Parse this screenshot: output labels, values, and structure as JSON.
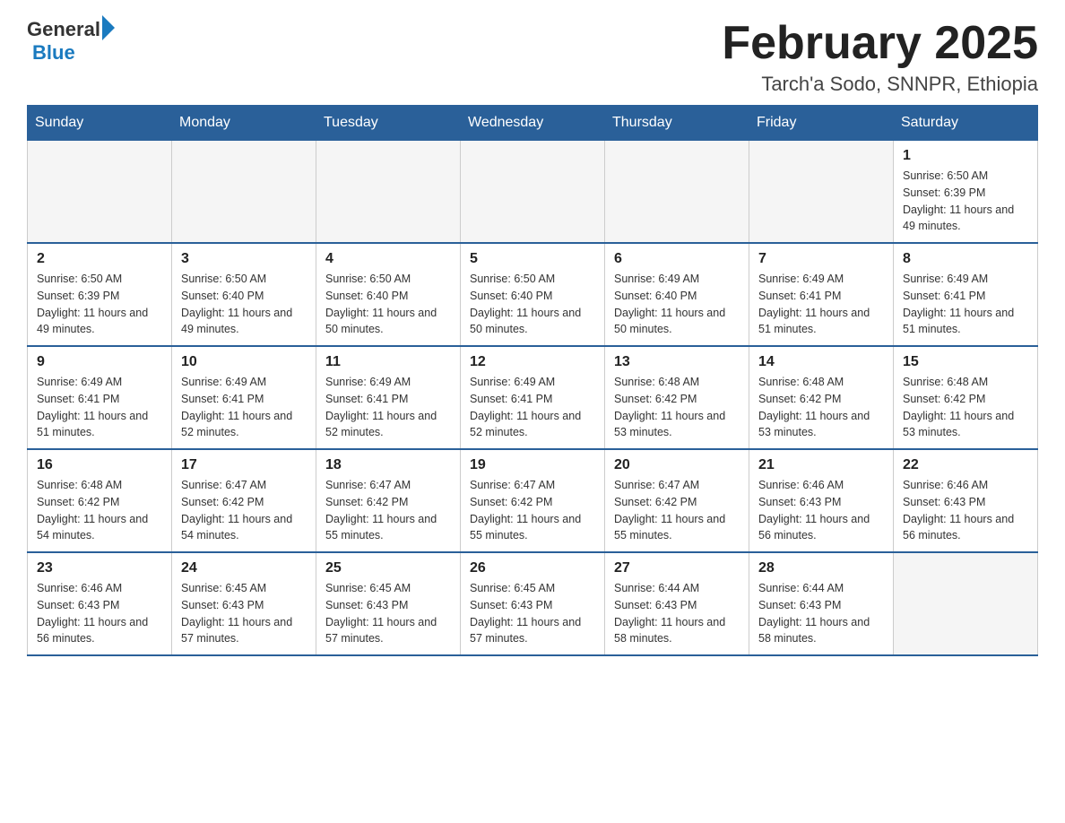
{
  "header": {
    "title": "February 2025",
    "subtitle": "Tarch'a Sodo, SNNPR, Ethiopia",
    "logo_general": "General",
    "logo_blue": "Blue"
  },
  "days_of_week": [
    "Sunday",
    "Monday",
    "Tuesday",
    "Wednesday",
    "Thursday",
    "Friday",
    "Saturday"
  ],
  "weeks": [
    {
      "days": [
        {
          "number": "",
          "info": ""
        },
        {
          "number": "",
          "info": ""
        },
        {
          "number": "",
          "info": ""
        },
        {
          "number": "",
          "info": ""
        },
        {
          "number": "",
          "info": ""
        },
        {
          "number": "",
          "info": ""
        },
        {
          "number": "1",
          "info": "Sunrise: 6:50 AM\nSunset: 6:39 PM\nDaylight: 11 hours and 49 minutes."
        }
      ]
    },
    {
      "days": [
        {
          "number": "2",
          "info": "Sunrise: 6:50 AM\nSunset: 6:39 PM\nDaylight: 11 hours and 49 minutes."
        },
        {
          "number": "3",
          "info": "Sunrise: 6:50 AM\nSunset: 6:40 PM\nDaylight: 11 hours and 49 minutes."
        },
        {
          "number": "4",
          "info": "Sunrise: 6:50 AM\nSunset: 6:40 PM\nDaylight: 11 hours and 50 minutes."
        },
        {
          "number": "5",
          "info": "Sunrise: 6:50 AM\nSunset: 6:40 PM\nDaylight: 11 hours and 50 minutes."
        },
        {
          "number": "6",
          "info": "Sunrise: 6:49 AM\nSunset: 6:40 PM\nDaylight: 11 hours and 50 minutes."
        },
        {
          "number": "7",
          "info": "Sunrise: 6:49 AM\nSunset: 6:41 PM\nDaylight: 11 hours and 51 minutes."
        },
        {
          "number": "8",
          "info": "Sunrise: 6:49 AM\nSunset: 6:41 PM\nDaylight: 11 hours and 51 minutes."
        }
      ]
    },
    {
      "days": [
        {
          "number": "9",
          "info": "Sunrise: 6:49 AM\nSunset: 6:41 PM\nDaylight: 11 hours and 51 minutes."
        },
        {
          "number": "10",
          "info": "Sunrise: 6:49 AM\nSunset: 6:41 PM\nDaylight: 11 hours and 52 minutes."
        },
        {
          "number": "11",
          "info": "Sunrise: 6:49 AM\nSunset: 6:41 PM\nDaylight: 11 hours and 52 minutes."
        },
        {
          "number": "12",
          "info": "Sunrise: 6:49 AM\nSunset: 6:41 PM\nDaylight: 11 hours and 52 minutes."
        },
        {
          "number": "13",
          "info": "Sunrise: 6:48 AM\nSunset: 6:42 PM\nDaylight: 11 hours and 53 minutes."
        },
        {
          "number": "14",
          "info": "Sunrise: 6:48 AM\nSunset: 6:42 PM\nDaylight: 11 hours and 53 minutes."
        },
        {
          "number": "15",
          "info": "Sunrise: 6:48 AM\nSunset: 6:42 PM\nDaylight: 11 hours and 53 minutes."
        }
      ]
    },
    {
      "days": [
        {
          "number": "16",
          "info": "Sunrise: 6:48 AM\nSunset: 6:42 PM\nDaylight: 11 hours and 54 minutes."
        },
        {
          "number": "17",
          "info": "Sunrise: 6:47 AM\nSunset: 6:42 PM\nDaylight: 11 hours and 54 minutes."
        },
        {
          "number": "18",
          "info": "Sunrise: 6:47 AM\nSunset: 6:42 PM\nDaylight: 11 hours and 55 minutes."
        },
        {
          "number": "19",
          "info": "Sunrise: 6:47 AM\nSunset: 6:42 PM\nDaylight: 11 hours and 55 minutes."
        },
        {
          "number": "20",
          "info": "Sunrise: 6:47 AM\nSunset: 6:42 PM\nDaylight: 11 hours and 55 minutes."
        },
        {
          "number": "21",
          "info": "Sunrise: 6:46 AM\nSunset: 6:43 PM\nDaylight: 11 hours and 56 minutes."
        },
        {
          "number": "22",
          "info": "Sunrise: 6:46 AM\nSunset: 6:43 PM\nDaylight: 11 hours and 56 minutes."
        }
      ]
    },
    {
      "days": [
        {
          "number": "23",
          "info": "Sunrise: 6:46 AM\nSunset: 6:43 PM\nDaylight: 11 hours and 56 minutes."
        },
        {
          "number": "24",
          "info": "Sunrise: 6:45 AM\nSunset: 6:43 PM\nDaylight: 11 hours and 57 minutes."
        },
        {
          "number": "25",
          "info": "Sunrise: 6:45 AM\nSunset: 6:43 PM\nDaylight: 11 hours and 57 minutes."
        },
        {
          "number": "26",
          "info": "Sunrise: 6:45 AM\nSunset: 6:43 PM\nDaylight: 11 hours and 57 minutes."
        },
        {
          "number": "27",
          "info": "Sunrise: 6:44 AM\nSunset: 6:43 PM\nDaylight: 11 hours and 58 minutes."
        },
        {
          "number": "28",
          "info": "Sunrise: 6:44 AM\nSunset: 6:43 PM\nDaylight: 11 hours and 58 minutes."
        },
        {
          "number": "",
          "info": ""
        }
      ]
    }
  ]
}
